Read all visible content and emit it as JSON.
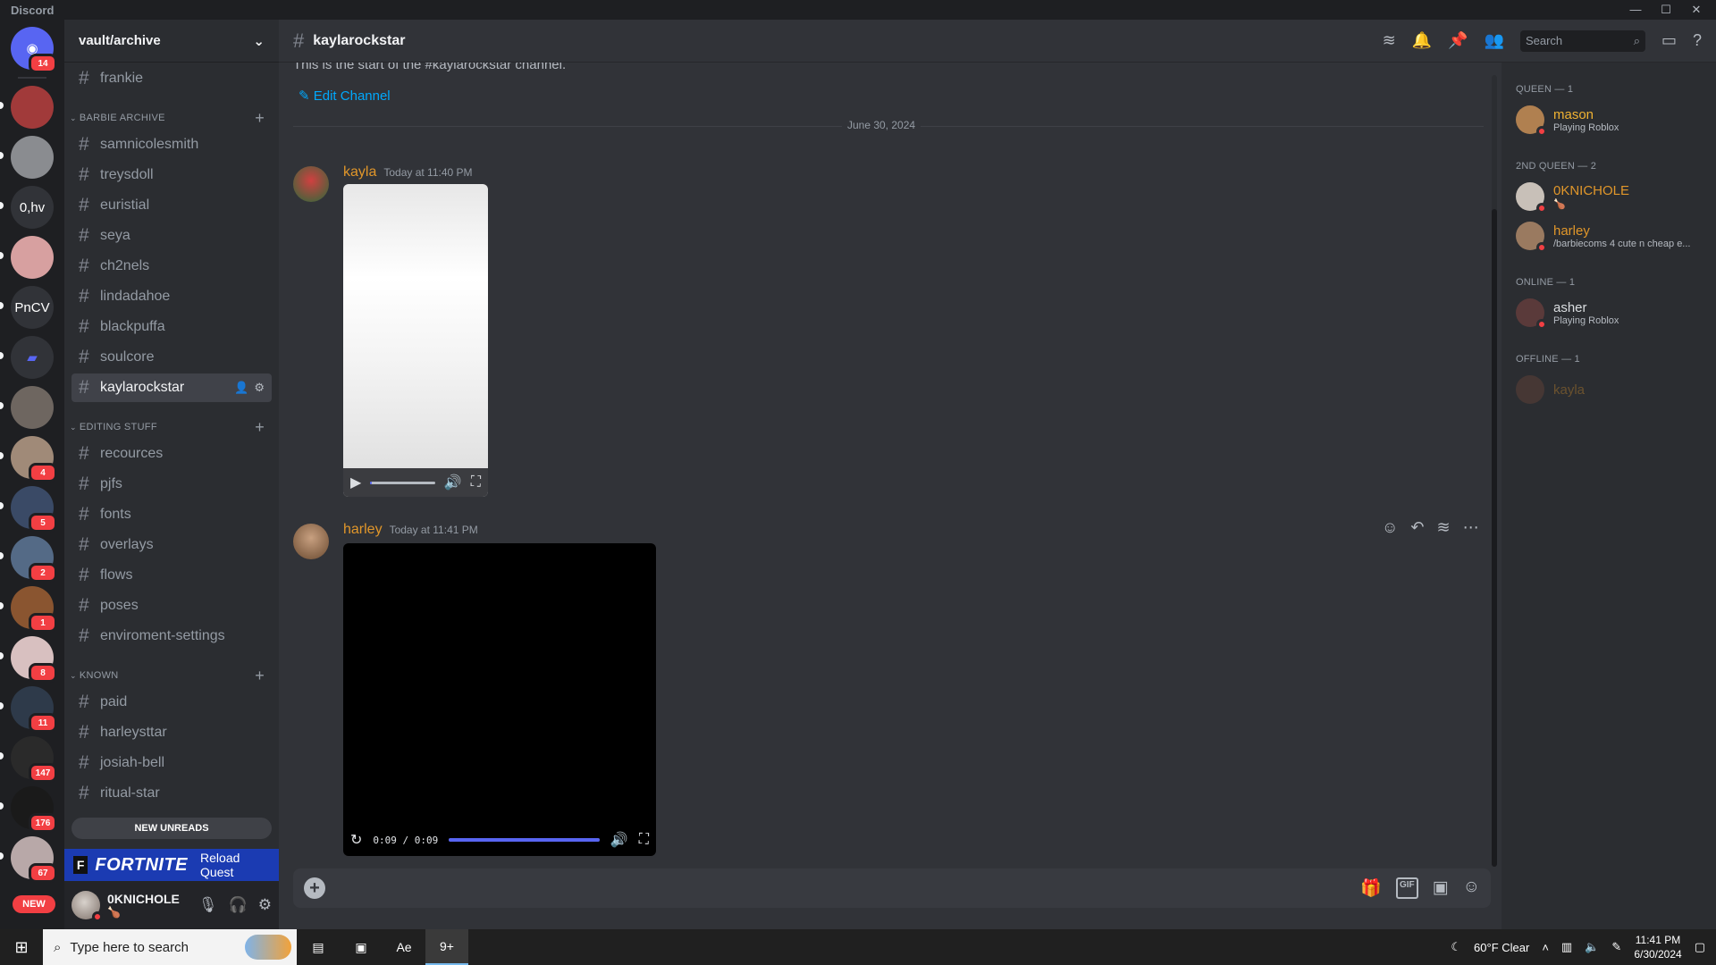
{
  "app": {
    "title": "Discord"
  },
  "guilds": [
    {
      "label": "",
      "badge": "14",
      "color": "#5865f2",
      "icon": "discord-home-icon"
    },
    {
      "label": "",
      "badge": "",
      "color": "#a13a3a"
    },
    {
      "label": "",
      "badge": "",
      "color": "#8a8c90"
    },
    {
      "label": "0,hv",
      "badge": "",
      "color": "#313338"
    },
    {
      "label": "",
      "badge": "",
      "color": "#d7a0a0"
    },
    {
      "label": "PnCV",
      "badge": "",
      "color": "#313338"
    },
    {
      "label": "",
      "badge": "",
      "color": "#313338",
      "icon": "folder-icon"
    },
    {
      "label": "",
      "badge": "",
      "color": "#6e6660"
    },
    {
      "label": "",
      "badge": "4",
      "color": "#a08a78"
    },
    {
      "label": "",
      "badge": "5",
      "color": "#3a4a66"
    },
    {
      "label": "",
      "badge": "2",
      "color": "#546a86"
    },
    {
      "label": "",
      "badge": "1",
      "color": "#8a5530"
    },
    {
      "label": "",
      "badge": "8",
      "color": "#d8c0c0"
    },
    {
      "label": "",
      "badge": "11",
      "color": "#2e3a4a"
    },
    {
      "label": "",
      "badge": "147",
      "color": "#2a2a2a"
    },
    {
      "label": "",
      "badge": "176",
      "color": "#1a1a1a"
    },
    {
      "label": "",
      "badge": "67",
      "color": "#b8a8a8"
    }
  ],
  "new_pill": "NEW",
  "server": {
    "name": "vault/archive"
  },
  "channels": {
    "top": [
      {
        "name": "frankie"
      }
    ],
    "categories": [
      {
        "name": "BARBIE ARCHIVE",
        "channels": [
          "samnicolesmith",
          "treysdoll",
          "euristial",
          "seya",
          "ch2nels",
          "lindadahoe",
          "blackpuffa",
          "soulcore",
          "kaylarockstar"
        ]
      },
      {
        "name": "EDITING STUFF",
        "channels": [
          "recources",
          "pjfs",
          "fonts",
          "overlays",
          "flows",
          "poses",
          "enviroment-settings"
        ]
      },
      {
        "name": "KNOWN",
        "channels": [
          "paid",
          "harleysttar",
          "josiah-bell",
          "ritual-star"
        ]
      }
    ],
    "active": "kaylarockstar"
  },
  "new_unreads": "NEW UNREADS",
  "quest": {
    "badge": "F",
    "game": "FORTNITE",
    "label": "Reload Quest"
  },
  "user": {
    "name": "0KNICHOLE",
    "status": "🍗"
  },
  "channel_header": {
    "name": "kaylarockstar",
    "search_placeholder": "Search"
  },
  "chat": {
    "intro": "This is the start of the #kaylarockstar channel.",
    "edit_channel": "Edit Channel",
    "date_divider": "June 30, 2024",
    "messages": [
      {
        "author": "kayla",
        "time": "Today at 11:40 PM",
        "video": {
          "progress": 0.03
        }
      },
      {
        "author": "harley",
        "time": "Today at 11:41 PM",
        "video": {
          "timecode": "0:09 / 0:09",
          "progress": 1.0
        }
      }
    ],
    "composer": {
      "gif_label": "GIF"
    }
  },
  "members": [
    {
      "group": "QUEEN — 1",
      "users": [
        {
          "name": "mason",
          "sub": "Playing Roblox",
          "color": "#f0b232",
          "avatar": "#b08050"
        }
      ]
    },
    {
      "group": "2ND QUEEN — 2",
      "users": [
        {
          "name": "0KNICHOLE",
          "sub": "🍗",
          "color": "#e0962a",
          "avatar": "#c8c0b8"
        },
        {
          "name": "harley",
          "sub": "/barbiecoms 4 cute n cheap e...",
          "color": "#e0962a",
          "avatar": "#9a7a60"
        }
      ]
    },
    {
      "group": "ONLINE — 1",
      "users": [
        {
          "name": "asher",
          "sub": "Playing Roblox",
          "color": "#dbdee1",
          "avatar": "#5a3a3a"
        }
      ]
    },
    {
      "group": "OFFLINE — 1",
      "users": [
        {
          "name": "kayla",
          "sub": "",
          "color": "#e0962a",
          "avatar": "#7a4a3a",
          "offline": true
        }
      ]
    }
  ],
  "taskbar": {
    "search_placeholder": "Type here to search",
    "weather": "60°F  Clear",
    "time": "11:41 PM",
    "date": "6/30/2024",
    "discord_badge": "9+"
  }
}
